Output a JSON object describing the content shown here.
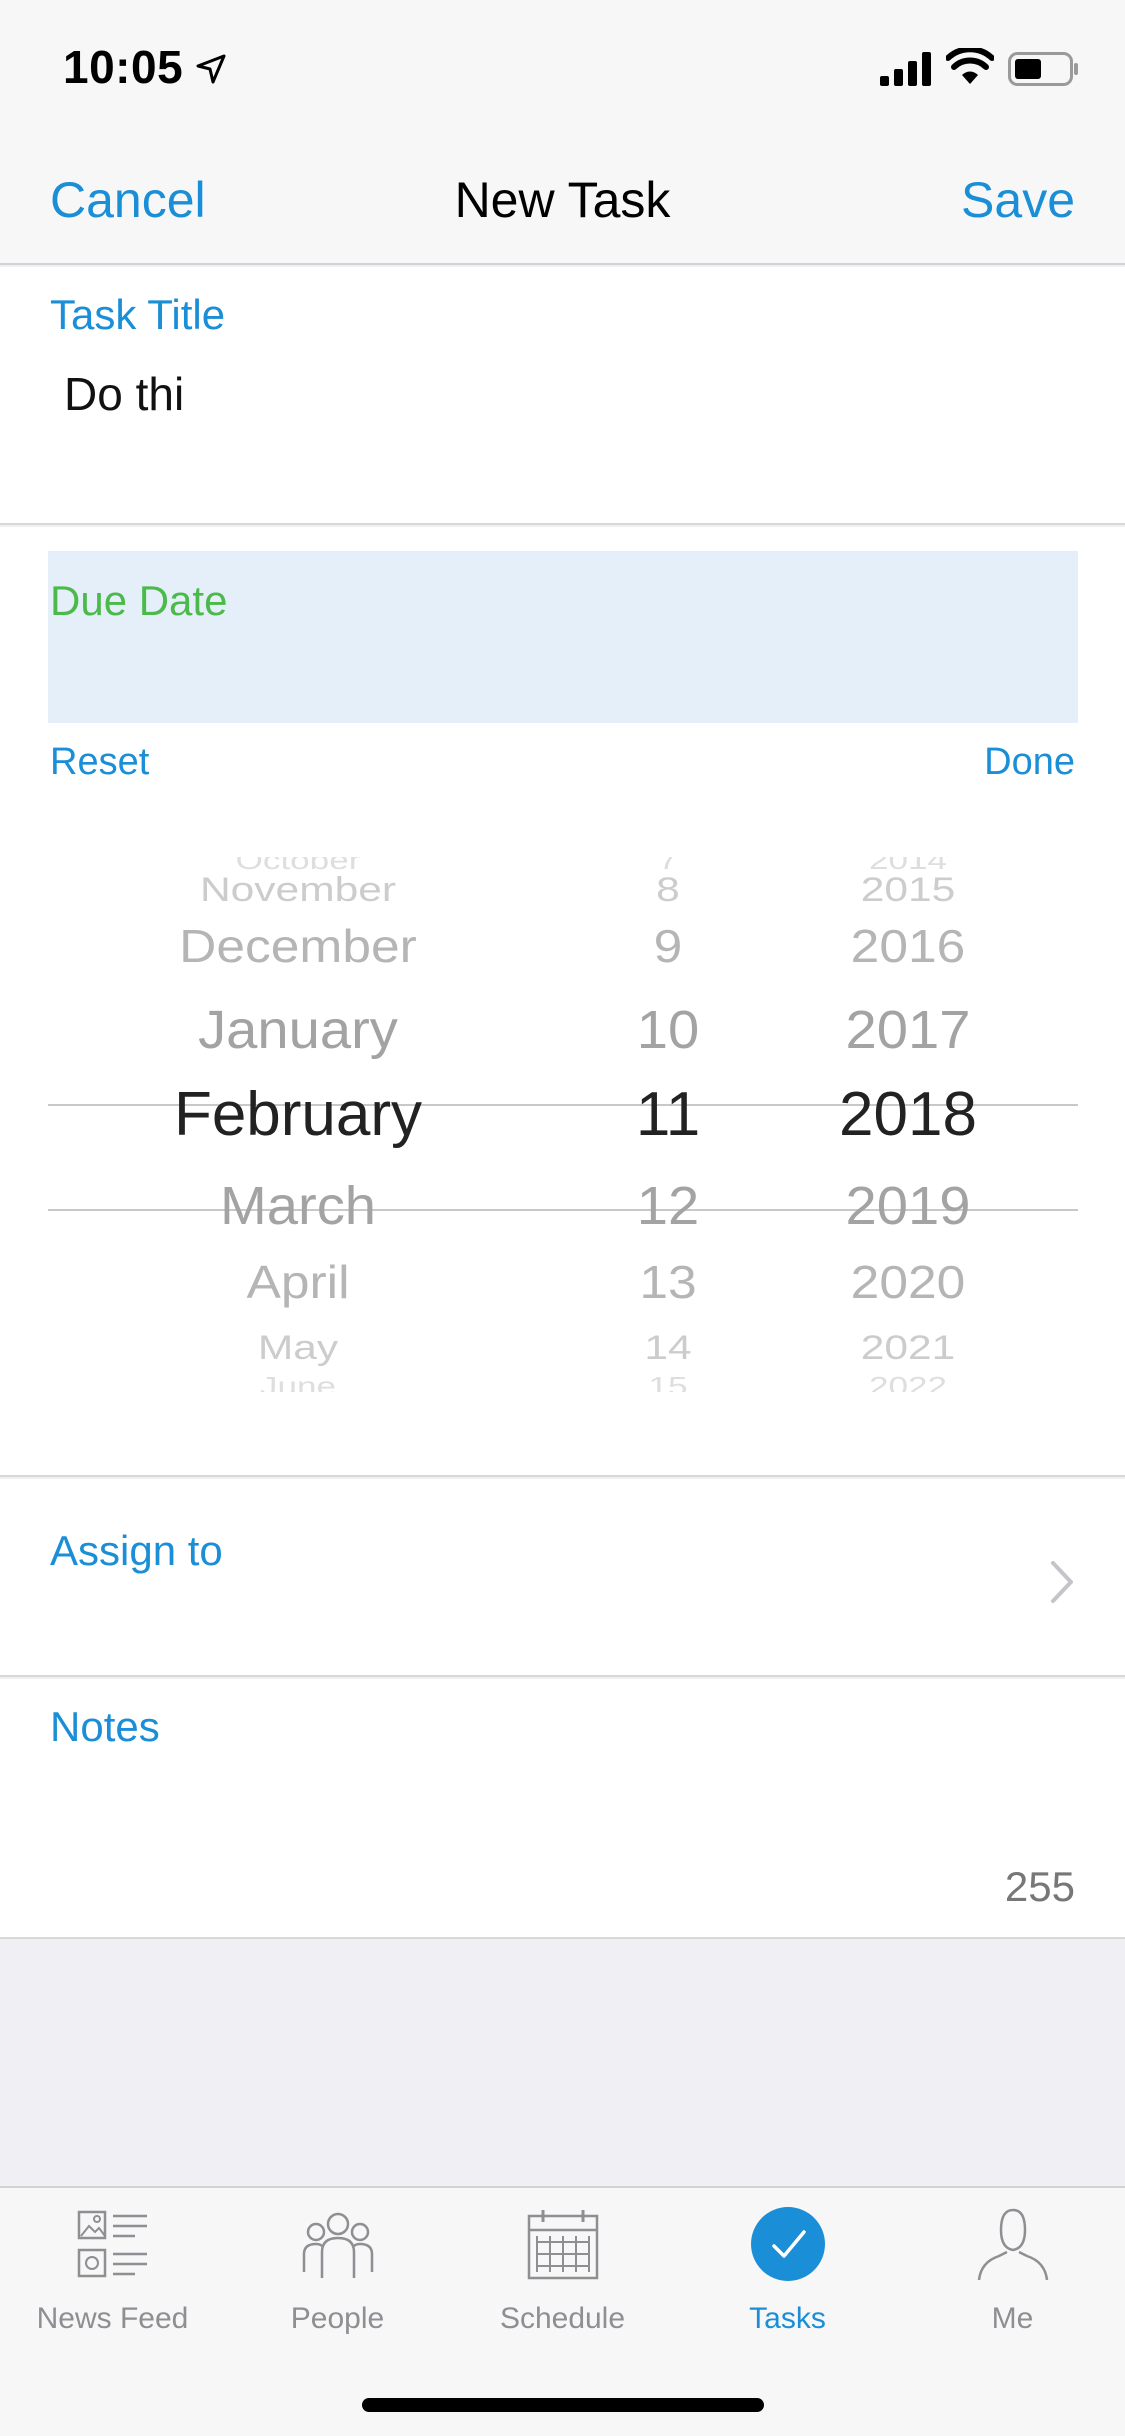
{
  "status_bar": {
    "time": "10:05"
  },
  "nav": {
    "cancel": "Cancel",
    "title": "New Task",
    "save": "Save"
  },
  "task": {
    "label": "Task Title",
    "value": "Do thi"
  },
  "due": {
    "label": "Due Date",
    "reset": "Reset",
    "done": "Done",
    "months": [
      "October",
      "November",
      "December",
      "January",
      "February",
      "March",
      "April",
      "May",
      "June"
    ],
    "days": [
      "7",
      "8",
      "9",
      "10",
      "11",
      "12",
      "13",
      "14",
      "15"
    ],
    "years": [
      "2014",
      "2015",
      "2016",
      "2017",
      "2018",
      "2019",
      "2020",
      "2021",
      "2022"
    ],
    "selected": {
      "month": "February",
      "day": "11",
      "year": "2018"
    }
  },
  "assign": {
    "label": "Assign to"
  },
  "notes": {
    "label": "Notes",
    "remaining": "255"
  },
  "tabs": [
    {
      "label": "News Feed",
      "icon": "news-feed-icon"
    },
    {
      "label": "People",
      "icon": "people-icon"
    },
    {
      "label": "Schedule",
      "icon": "calendar-icon"
    },
    {
      "label": "Tasks",
      "icon": "checkmark-circle-icon",
      "active": true
    },
    {
      "label": "Me",
      "icon": "person-icon"
    }
  ],
  "colors": {
    "accent": "#1a8ed6",
    "due_label": "#4cba4a",
    "due_highlight": "#e4eff9"
  }
}
